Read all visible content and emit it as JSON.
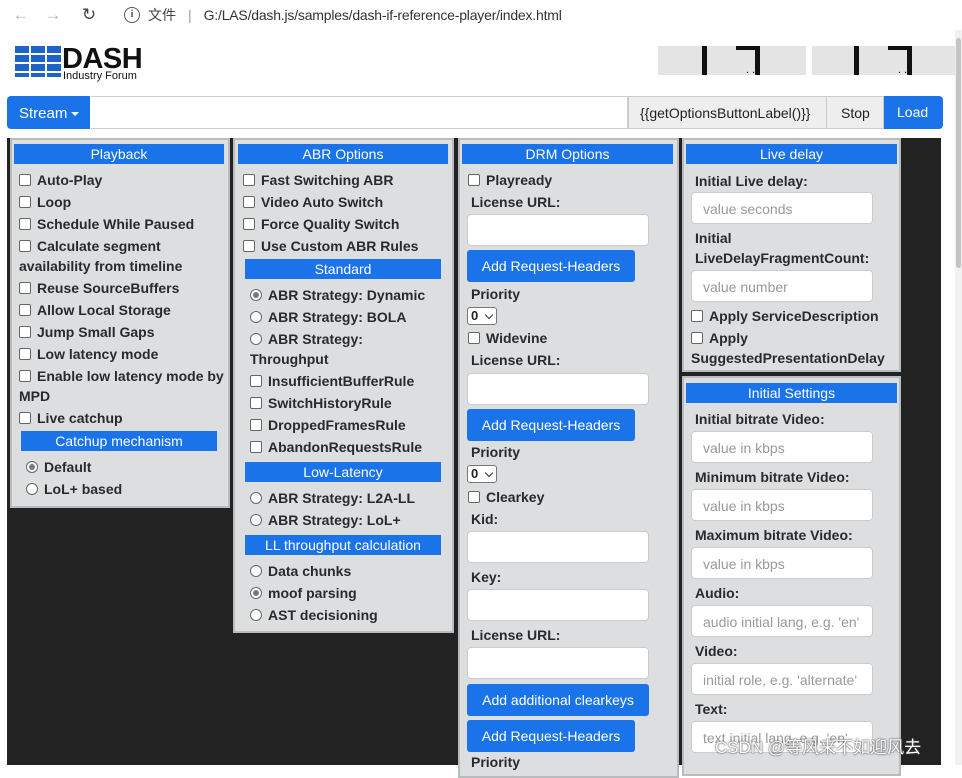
{
  "browser": {
    "back_icon": "back-arrow-icon",
    "forward_icon": "forward-arrow-icon",
    "reload_icon": "reload-icon",
    "info_icon": "info-icon",
    "protocol_label": "文件",
    "separator": "|",
    "url": "G:/LAS/dash.js/samples/dash-if-reference-player/index.html"
  },
  "logo": {
    "title": "DASH",
    "subtitle": "Industry Forum"
  },
  "toolbar": {
    "stream_label": "Stream",
    "url_value": "",
    "options_label": "{{getOptionsButtonLabel()}}",
    "stop_label": "Stop",
    "load_label": "Load"
  },
  "playback": {
    "title": "Playback",
    "options": [
      {
        "label": "Auto-Play",
        "checked": false
      },
      {
        "label": "Loop",
        "checked": false
      },
      {
        "label": "Schedule While Paused",
        "checked": false
      },
      {
        "label": "Calculate segment availability from timeline",
        "checked": false
      },
      {
        "label": "Reuse SourceBuffers",
        "checked": false
      },
      {
        "label": "Allow Local Storage",
        "checked": false
      },
      {
        "label": "Jump Small Gaps",
        "checked": false
      },
      {
        "label": "Low latency mode",
        "checked": false
      },
      {
        "label": "Enable low latency mode by MPD",
        "checked": false
      },
      {
        "label": "Live catchup",
        "checked": false
      }
    ],
    "catchup_title": "Catchup mechanism",
    "catchup": [
      {
        "label": "Default",
        "selected": true
      },
      {
        "label": "LoL+ based",
        "selected": false
      }
    ]
  },
  "abr": {
    "title": "ABR Options",
    "options": [
      {
        "label": "Fast Switching ABR",
        "checked": false
      },
      {
        "label": "Video Auto Switch",
        "checked": false
      },
      {
        "label": "Force Quality Switch",
        "checked": false
      },
      {
        "label": "Use Custom ABR Rules",
        "checked": false
      }
    ],
    "standard_title": "Standard",
    "standard": [
      {
        "label": "ABR Strategy: Dynamic",
        "selected": true
      },
      {
        "label": "ABR Strategy: BOLA",
        "selected": false
      },
      {
        "label": "ABR Strategy: Throughput",
        "selected": false
      }
    ],
    "rules": [
      {
        "label": "InsufficientBufferRule",
        "checked": false
      },
      {
        "label": "SwitchHistoryRule",
        "checked": false
      },
      {
        "label": "DroppedFramesRule",
        "checked": false
      },
      {
        "label": "AbandonRequestsRule",
        "checked": false
      }
    ],
    "lowlat_title": "Low-Latency",
    "lowlat": [
      {
        "label": "ABR Strategy: L2A-LL",
        "selected": false
      },
      {
        "label": "ABR Strategy: LoL+",
        "selected": false
      }
    ],
    "llcalc_title": "LL throughput calculation",
    "llcalc": [
      {
        "label": "Data chunks",
        "selected": false
      },
      {
        "label": "moof parsing",
        "selected": true
      },
      {
        "label": "AST decisioning",
        "selected": false
      }
    ]
  },
  "drm": {
    "title": "DRM Options",
    "playready_label": "Playready",
    "license_label": "License URL:",
    "add_headers_label": "Add Request-Headers",
    "priority_label": "Priority",
    "priority_value": "0",
    "widevine_label": "Widevine",
    "clearkey_label": "Clearkey",
    "kid_label": "Kid:",
    "key_label": "Key:",
    "add_clearkeys_label": "Add additional clearkeys"
  },
  "live": {
    "title": "Live delay",
    "initial_delay_label": "Initial Live delay:",
    "initial_delay_placeholder": "value seconds",
    "fragment_count_label": "Initial LiveDelayFragmentCount:",
    "fragment_count_placeholder": "value number",
    "apply_service_label": "Apply ServiceDescription",
    "apply_suggested_label": "Apply SuggestedPresentationDelay"
  },
  "initial": {
    "title": "Initial Settings",
    "bitrate_video_label": "Initial bitrate Video:",
    "bitrate_placeholder": "value in kbps",
    "min_bitrate_label": "Minimum bitrate Video:",
    "max_bitrate_label": "Maximum bitrate Video:",
    "audio_label": "Audio:",
    "audio_placeholder": "audio initial lang, e.g. 'en'",
    "video_label": "Video:",
    "video_placeholder": "initial role, e.g. 'alternate'",
    "text_label": "Text:",
    "text_placeholder": "text initial lang, e.g. 'en'"
  },
  "watermark": "CSDN @等风来不如迎风去"
}
